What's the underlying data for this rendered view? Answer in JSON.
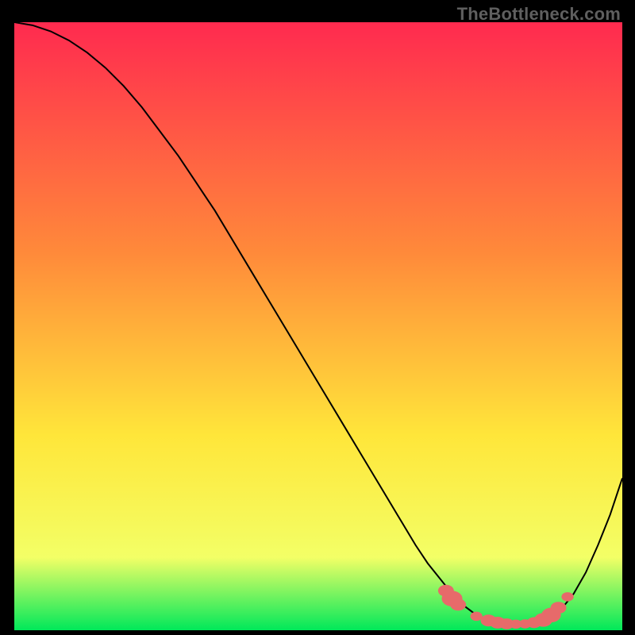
{
  "watermark": "TheBottleneck.com",
  "colors": {
    "gradient_top": "#ff2a4f",
    "gradient_mid1": "#ff8a3a",
    "gradient_mid2": "#ffe63a",
    "gradient_mid3": "#f3ff66",
    "gradient_bottom": "#00e85a",
    "curve": "#000000",
    "markers": "#e76a6a",
    "frame": "#000000"
  },
  "chart_data": {
    "type": "line",
    "title": "",
    "xlabel": "",
    "ylabel": "",
    "xlim": [
      0,
      100
    ],
    "ylim": [
      0,
      100
    ],
    "series": [
      {
        "name": "bottleneck-curve",
        "x": [
          0,
          3,
          6,
          9,
          12,
          15,
          18,
          21,
          24,
          27,
          30,
          33,
          36,
          39,
          42,
          45,
          48,
          51,
          54,
          57,
          60,
          63,
          66,
          68,
          70,
          72,
          74,
          76,
          78,
          80,
          82,
          84,
          86,
          88,
          90,
          92,
          94,
          96,
          98,
          100
        ],
        "y": [
          100,
          99.5,
          98.5,
          97,
          95,
          92.5,
          89.5,
          86,
          82,
          78,
          73.5,
          69,
          64,
          59,
          54,
          49,
          44,
          39,
          34,
          29,
          24,
          19,
          14,
          11,
          8.5,
          6,
          4,
          2.5,
          1.5,
          1,
          1,
          1,
          1.3,
          2,
          3.5,
          6,
          9.5,
          14,
          19,
          25
        ]
      }
    ],
    "markers": {
      "name": "highlight-dots",
      "points": [
        {
          "x": 71,
          "y": 6.5,
          "r": 1.3
        },
        {
          "x": 72,
          "y": 5.2,
          "r": 1.7
        },
        {
          "x": 73,
          "y": 4.2,
          "r": 1.3
        },
        {
          "x": 76,
          "y": 2.3,
          "r": 1.0
        },
        {
          "x": 78,
          "y": 1.6,
          "r": 1.3
        },
        {
          "x": 79.5,
          "y": 1.25,
          "r": 1.3
        },
        {
          "x": 81,
          "y": 1.05,
          "r": 1.2
        },
        {
          "x": 82.5,
          "y": 1.0,
          "r": 1.0
        },
        {
          "x": 84,
          "y": 1.05,
          "r": 1.0
        },
        {
          "x": 85.5,
          "y": 1.25,
          "r": 1.2
        },
        {
          "x": 87,
          "y": 1.7,
          "r": 1.5
        },
        {
          "x": 88.3,
          "y": 2.5,
          "r": 1.6
        },
        {
          "x": 89.5,
          "y": 3.7,
          "r": 1.3
        },
        {
          "x": 91,
          "y": 5.5,
          "r": 1.0
        }
      ]
    }
  }
}
